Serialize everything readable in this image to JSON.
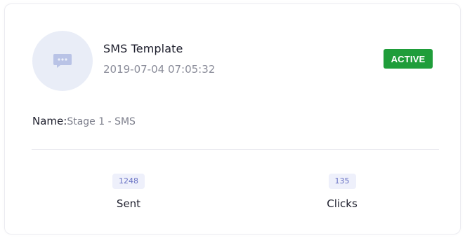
{
  "template": {
    "icon": "sms-chat-icon",
    "title": "SMS Template",
    "timestamp": "2019-07-04 07:05:32",
    "status": "ACTIVE",
    "name_label": "Name:",
    "name_value": "Stage 1 - SMS"
  },
  "stats": {
    "sent": {
      "value": "1248",
      "label": "Sent"
    },
    "clicks": {
      "value": "135",
      "label": "Clicks"
    }
  },
  "colors": {
    "accent": "#6a73c4",
    "status_active": "#1f9d3a",
    "avatar_bg": "#e9edf7"
  }
}
